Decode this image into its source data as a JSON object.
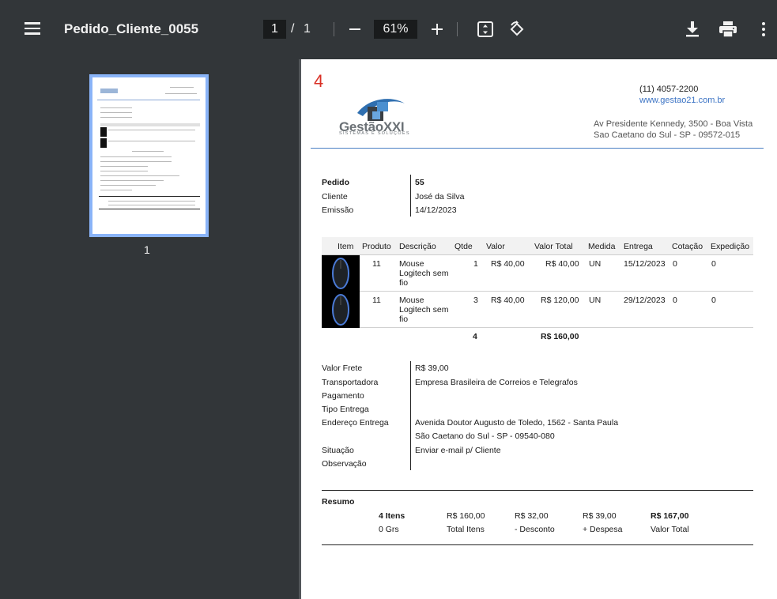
{
  "toolbar": {
    "title": "Pedido_Cliente_0055",
    "page_current": "1",
    "page_sep": "/",
    "page_total": "1",
    "zoom": "61%"
  },
  "sidebar": {
    "thumb_label": "1"
  },
  "page": {
    "page_number": "4",
    "logo": {
      "name": "GestãoXXI",
      "tagline": "SISTEMAS E SOLUÇÕES"
    },
    "header": {
      "phone": "(11) 4057-2200",
      "url": "www.gestao21.com.br",
      "address1": "Av Presidente Kennedy, 3500 - Boa Vista",
      "address2": "Sao Caetano do Sul - SP - 09572-015"
    },
    "order": {
      "pedido_label": "Pedido",
      "pedido_value": "55",
      "cliente_label": "Cliente",
      "cliente_value": "José da Silva",
      "emissao_label": "Emissão",
      "emissao_value": "14/12/2023"
    },
    "table": {
      "columns": [
        "Item",
        "Produto",
        "Descrição",
        "Qtde",
        "Valor",
        "Valor Total",
        "Medida",
        "Entrega",
        "Cotação",
        "Expedição"
      ],
      "rows": [
        {
          "produto": "11",
          "desc1": "Mouse",
          "desc2": "Logitech sem",
          "desc3": "fio",
          "qtde": "1",
          "valor": "R$ 40,00",
          "total": "R$ 40,00",
          "medida": "UN",
          "entrega": "15/12/2023",
          "cotacao": "0",
          "expedicao": "0"
        },
        {
          "produto": "11",
          "desc1": "Mouse",
          "desc2": "Logitech sem",
          "desc3": "fio",
          "qtde": "3",
          "valor": "R$ 40,00",
          "total": "R$ 120,00",
          "medida": "UN",
          "entrega": "29/12/2023",
          "cotacao": "0",
          "expedicao": "0"
        }
      ],
      "total_qtde": "4",
      "total_valor": "R$ 160,00"
    },
    "details": {
      "frete_label": "Valor Frete",
      "frete_value": "R$ 39,00",
      "transp_label": "Transportadora",
      "transp_value": "Empresa Brasileira de Correios e Telegrafos",
      "pag_label": "Pagamento",
      "tipo_label": "Tipo Entrega",
      "end_label": "Endereço Entrega",
      "end_value1": "Avenida Doutor Augusto de Toledo, 1562 - Santa Paula",
      "end_value2": "São Caetano do Sul - SP - 09540-080",
      "sit_label": "Situação",
      "sit_value": "Enviar e-mail p/ Cliente",
      "obs_label": "Observação"
    },
    "resumo": {
      "title": "Resumo",
      "itens": "4 Itens",
      "grs": "0 Grs",
      "total_itens_value": "R$ 160,00",
      "total_itens_label": "Total Itens",
      "desconto_value": "R$ 32,00",
      "desconto_label": "- Desconto",
      "despesa_value": "R$ 39,00",
      "despesa_label": "+ Despesa",
      "valor_total_value": "R$ 167,00",
      "valor_total_label": "Valor Total"
    }
  }
}
